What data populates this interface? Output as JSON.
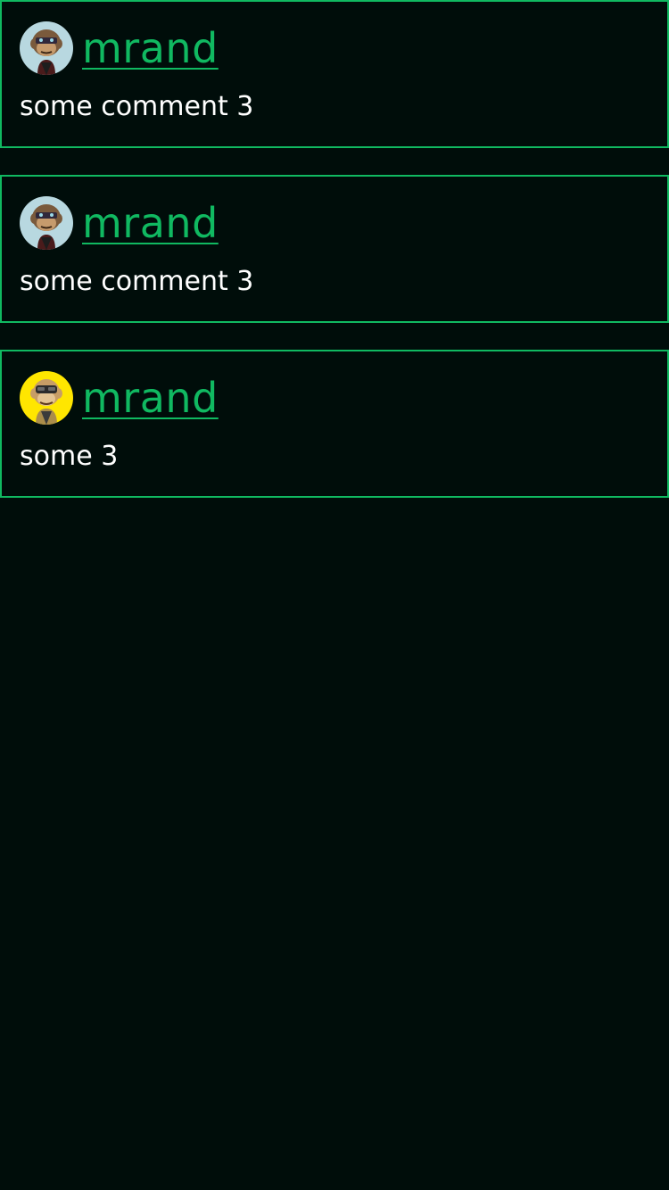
{
  "comments": [
    {
      "username": "mrand",
      "text": "some comment 3",
      "avatar": {
        "icon": "bored-ape-avatar-icon",
        "background": "#b8d8e0"
      }
    },
    {
      "username": "mrand",
      "text": "some comment 3",
      "avatar": {
        "icon": "bored-ape-avatar-icon",
        "background": "#b8d8e0"
      }
    },
    {
      "username": "mrand",
      "text": "some 3",
      "avatar": {
        "icon": "bored-ape-avatar-icon",
        "background": "#ffe600"
      }
    }
  ],
  "colors": {
    "page_background": "#000d0a",
    "accent": "#10b961",
    "text": "#ffffff"
  }
}
